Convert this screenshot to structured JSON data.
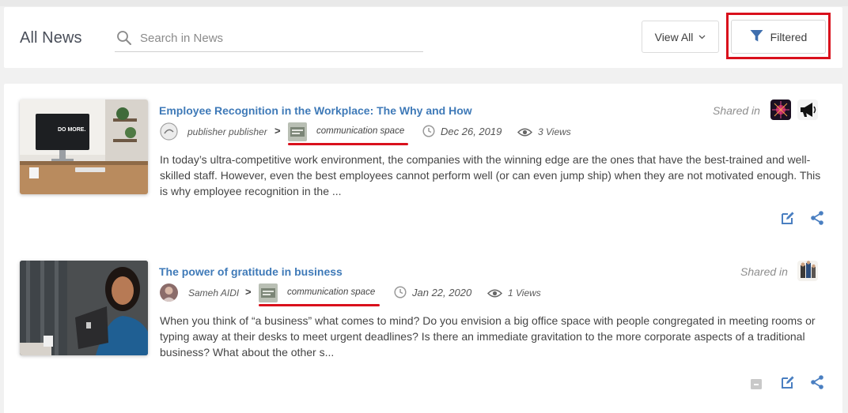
{
  "header": {
    "title": "All News",
    "search_placeholder": "Search in News",
    "view_all_label": "View All",
    "filtered_label": "Filtered"
  },
  "news": [
    {
      "title": "Employee Recognition in the Workplace: The Why and How",
      "author": "publisher publisher",
      "separator": ">",
      "space": "communication space",
      "date": "Dec 26, 2019",
      "views": "3 Views",
      "shared_label": "Shared in",
      "excerpt": "In today’s ultra-competitive work environment, the companies with the winning edge are the ones that have the best-trained and well-skilled staff. However, even the best employees cannot perform well (or can even jump ship) when they are not motivated enough. This is why employee recognition in the ...",
      "thumb_text": "DO MORE."
    },
    {
      "title": "The power of gratitude in business",
      "author": "Sameh AIDI",
      "separator": ">",
      "space": "communication space",
      "date": "Jan 22, 2020",
      "views": "1 Views",
      "shared_label": "Shared in",
      "excerpt": "When you think of “a business” what comes to mind? Do you envision a big office space with people congregated in meeting rooms or typing away at their desks to meet urgent deadlines? Is there an immediate gravitation to the more corporate aspects of a traditional business? What about the other s..."
    }
  ],
  "colors": {
    "link": "#3f7ab8",
    "highlight": "#d9101c",
    "action_icon": "#4a7fc1"
  },
  "icons": [
    "search-icon",
    "chevron-down-icon",
    "filter-icon",
    "clock-icon",
    "eye-icon",
    "megaphone-icon",
    "edit-icon",
    "share-icon",
    "archive-icon"
  ]
}
